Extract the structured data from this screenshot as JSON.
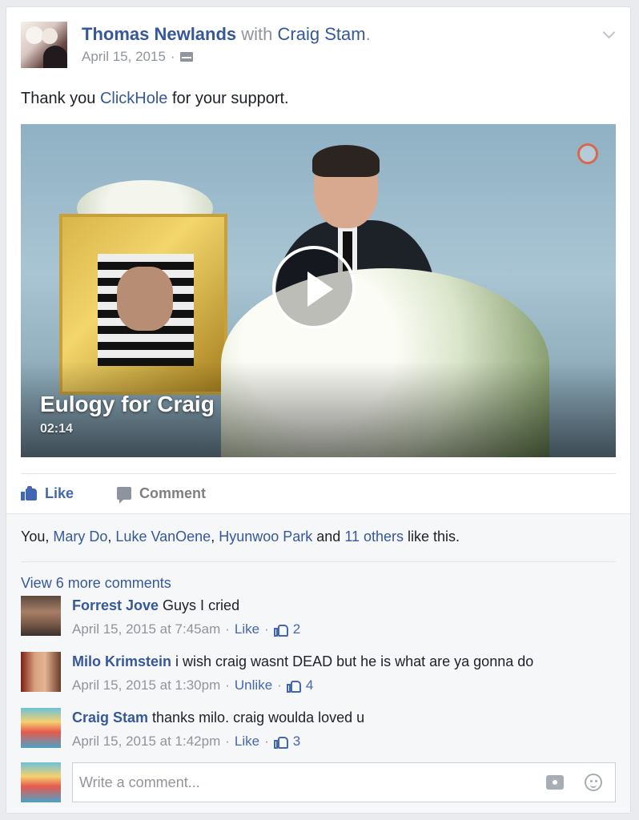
{
  "post": {
    "author": "Thomas Newlands",
    "with_word": " with ",
    "tagged": "Craig Stam",
    "tagged_suffix": ".",
    "date": "April 15, 2015",
    "date_sep": "·",
    "text_prefix": "Thank you ",
    "text_link": "ClickHole",
    "text_suffix": " for your support."
  },
  "video": {
    "title": "Eulogy for Craig",
    "duration": "02:14"
  },
  "actions": {
    "like_label": "Like",
    "comment_label": "Comment"
  },
  "likes": {
    "you": "You, ",
    "person1": "Mary Do",
    "sep1": ", ",
    "person2": "Luke VanOene",
    "sep2": ", ",
    "person3": "Hyunwoo Park",
    "and_text": " and ",
    "others": "11 others",
    "suffix": " like this."
  },
  "view_more": "View 6 more comments",
  "comments": [
    {
      "name": "Forrest Jove",
      "text": " Guys I cried",
      "time": "April 15, 2015 at 7:45am",
      "action": "Like",
      "likes": "2"
    },
    {
      "name": "Milo Krimstein",
      "text": " i wish craig wasnt DEAD but he is what are ya gonna do",
      "time": "April 15, 2015 at 1:30pm",
      "action": "Unlike",
      "likes": "4"
    },
    {
      "name": "Craig Stam",
      "text": " thanks milo. craig woulda loved u",
      "time": "April 15, 2015 at 1:42pm",
      "action": "Like",
      "likes": "3"
    }
  ],
  "composer": {
    "placeholder": "Write a comment..."
  },
  "meta_sep": "·",
  "colors": {
    "link": "#365899",
    "like_blue": "#4267b2",
    "meta_gray": "#90949c"
  }
}
